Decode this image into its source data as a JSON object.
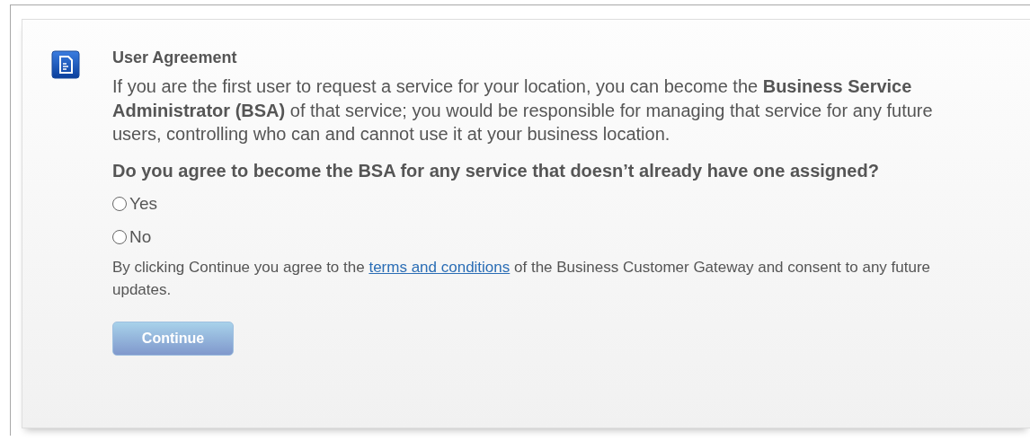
{
  "section": {
    "title": "User Agreement",
    "description": "If you are the first user to request a service for your location, you can become the **Business Service Administrator (BSA)** of that service; you would be responsible for managing that service for any future users, controlling who can and cannot use it at your business location.",
    "question": "Do you agree to become the BSA for any service that doesn’t already have one assigned?",
    "options": [
      {
        "label": "Yes",
        "selected": false
      },
      {
        "label": "No",
        "selected": false
      }
    ],
    "consent": {
      "before": "By clicking Continue you agree to the",
      "link": "terms and conditions",
      "after": "of the Business Customer Gateway and consent to any future updates."
    },
    "button": {
      "label": "Continue",
      "disabled": true
    }
  }
}
